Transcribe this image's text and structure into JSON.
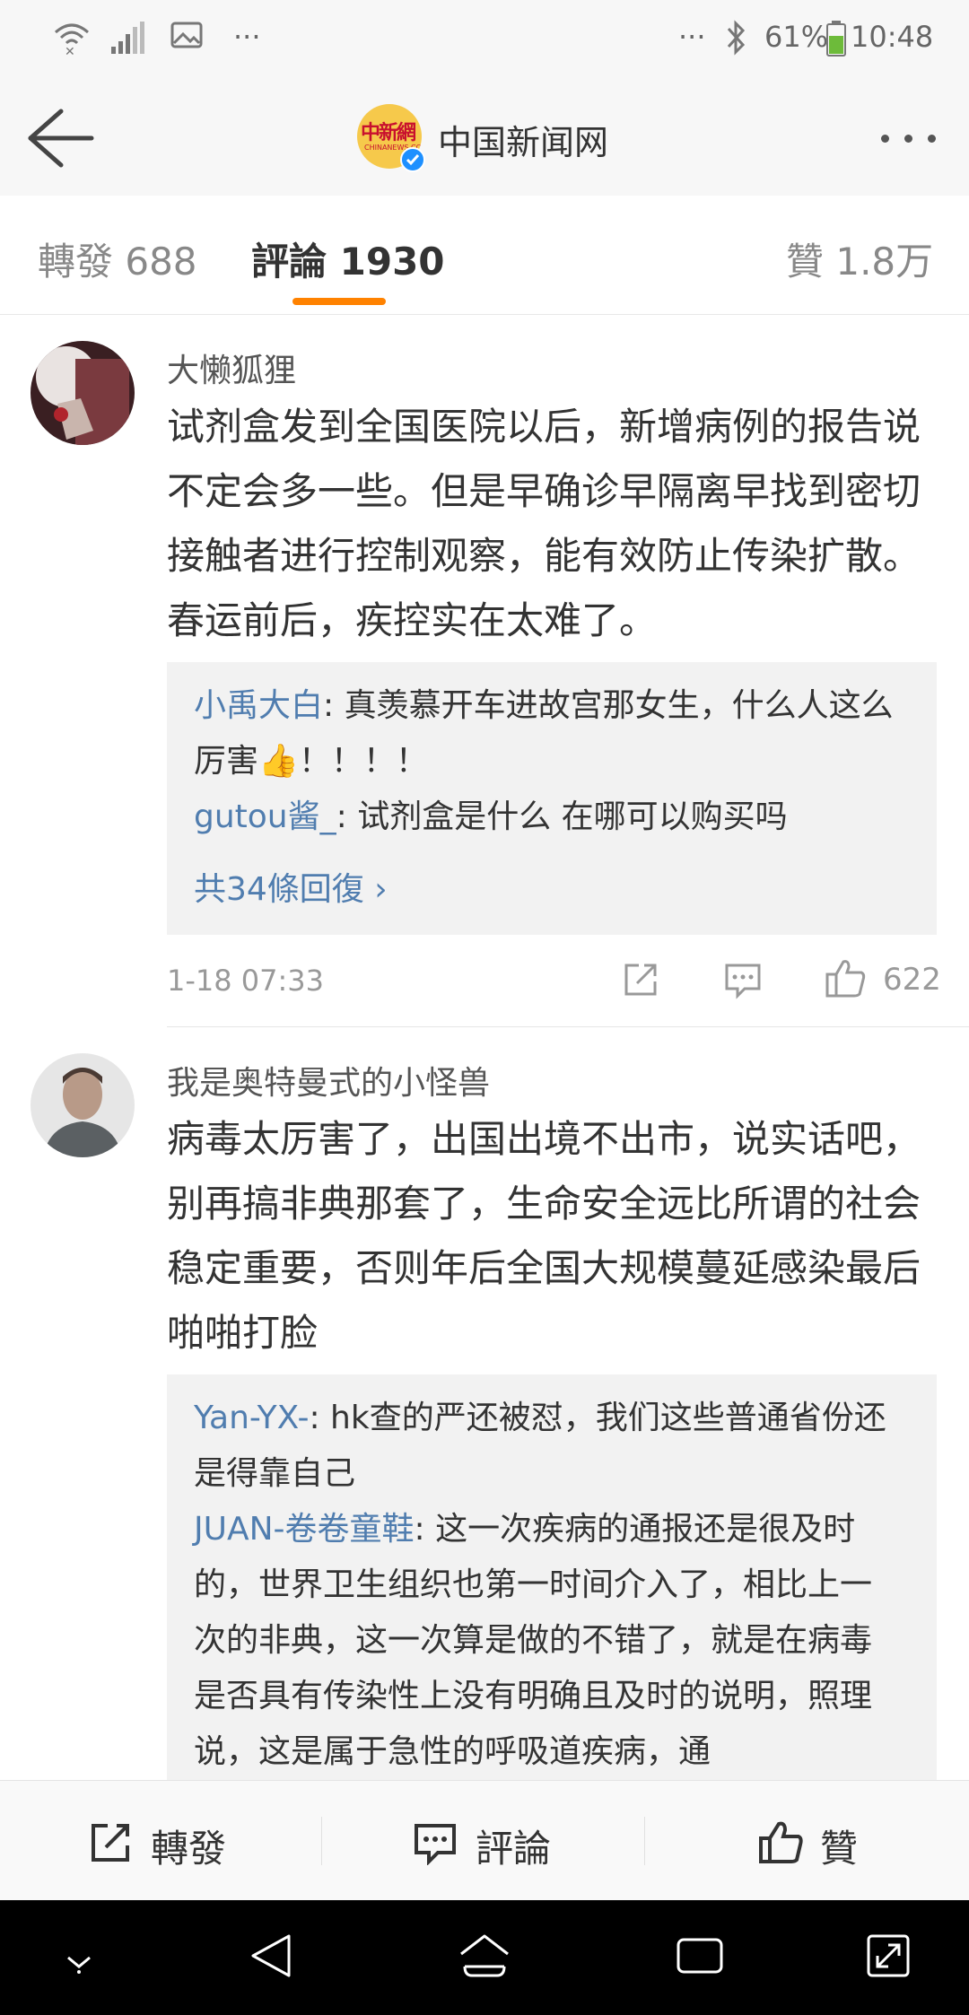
{
  "status_bar": {
    "more_left": "···",
    "more_right": "···",
    "battery": "61%",
    "time": "10:48"
  },
  "header": {
    "title": "中国新闻网",
    "logo_text": "中新網",
    "logo_sub": "CHINANEWS.COM"
  },
  "tabs": [
    {
      "label": "轉發 688"
    },
    {
      "label": "評論 1930"
    },
    {
      "label": "贊 1.8万"
    }
  ],
  "comments": [
    {
      "user": "大懒狐狸",
      "text": "试剂盒发到全国医院以后，新增病例的报告说不定会多一些。但是早确诊早隔离早找到密切接触者进行控制观察，能有效防止传染扩散。春运前后，疾控实在太难了。",
      "replies": [
        {
          "user": "小禹大白",
          "text": ": 真羡慕开车进故宫那女生，什么人这么厉害👍！！！！"
        },
        {
          "user": "gutou酱_",
          "text": ": 试剂盒是什么 在哪可以购买吗"
        }
      ],
      "more_replies": "共34條回復",
      "time": "1-18 07:33",
      "likes": "622"
    },
    {
      "user": "我是奥特曼式的小怪兽",
      "text": "病毒太厉害了，出国出境不出市，说实话吧，别再搞非典那套了，生命安全远比所谓的社会稳定重要，否则年后全国大规模蔓延感染最后啪啪打脸",
      "replies": [
        {
          "user": "Yan-YX-",
          "text": ": hk查的严还被怼，我们这些普通省份还是得靠自己"
        },
        {
          "user": "JUAN-卷卷童鞋",
          "text": ": 这一次疾病的通报还是很及时的，世界卫生组织也第一时间介入了，相比上一次的非典，这一次算是做的不错了，就是在病毒是否具有传染性上没有明确且及时的说明，照理说，这是属于急性的呼吸道疾病，通"
        }
      ]
    }
  ],
  "action_bar": {
    "repost": "轉發",
    "comment": "評論",
    "like": "贊"
  },
  "colors": {
    "accent": "#ff8200",
    "link": "#507daf"
  }
}
